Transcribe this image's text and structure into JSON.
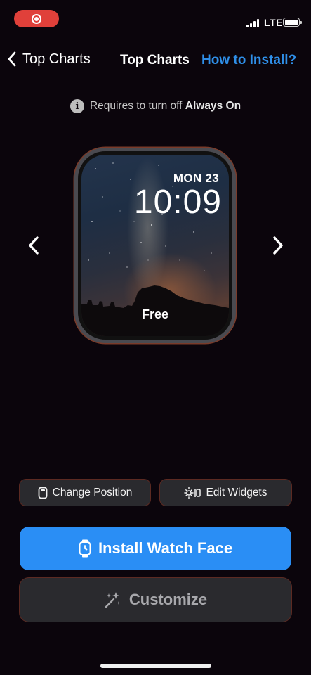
{
  "nav": {
    "back_label": "Top Charts",
    "title": "Top Charts",
    "help_link": "How to Install?"
  },
  "status": {
    "network": "LTE"
  },
  "notice": {
    "text": "Requires to turn off",
    "emphasis": "Always On",
    "icon": "info-icon"
  },
  "watch": {
    "date": "MON 23",
    "time": "10:09",
    "price": "Free",
    "wallpaper": "milky-way-desert-night"
  },
  "actions": {
    "change_position": "Change Position",
    "edit_widgets": "Edit Widgets",
    "install": "Install Watch Face",
    "customize": "Customize"
  },
  "colors": {
    "accent": "#2a8ef5",
    "link": "#2f8fe8",
    "recording": "#e0403a",
    "background": "#0b050c",
    "button_bg": "#2a2a2e"
  }
}
